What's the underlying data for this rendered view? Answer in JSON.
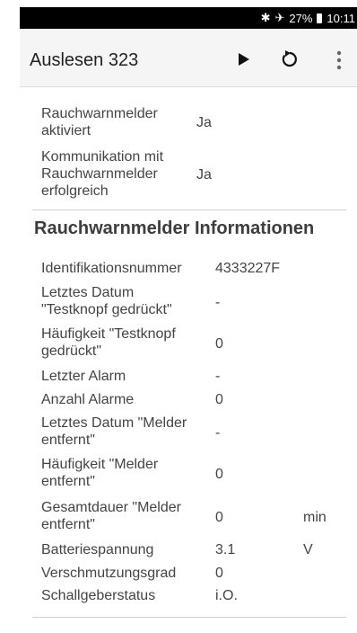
{
  "status_bar": {
    "icons": [
      "bluetooth-icon",
      "airplane-icon"
    ],
    "battery": "27%",
    "time": "10:11"
  },
  "app_bar": {
    "title": "Auslesen 323",
    "actions": [
      "play-icon",
      "refresh-icon",
      "more-vert-icon"
    ]
  },
  "top_rows": [
    {
      "label": "Rauchwarnmelder aktiviert",
      "value": "Ja"
    },
    {
      "label": "Kommunikation mit Rauchwarnmelder erfolgreich",
      "value": "Ja"
    }
  ],
  "section": {
    "heading": "Rauchwarnmelder Informationen",
    "rows": [
      {
        "label": "Identifikationsnummer",
        "value": "4333227F",
        "unit": ""
      },
      {
        "label": "Letztes Datum \"Testknopf gedrückt\"",
        "value": "-",
        "unit": ""
      },
      {
        "label": "Häufigkeit \"Testknopf gedrückt\"",
        "value": "0",
        "unit": ""
      },
      {
        "label": "Letzter Alarm",
        "value": "-",
        "unit": ""
      },
      {
        "label": "Anzahl Alarme",
        "value": "0",
        "unit": ""
      },
      {
        "label": "Letztes Datum \"Melder entfernt\"",
        "value": "-",
        "unit": ""
      },
      {
        "label": "Häufigkeit \"Melder entfernt\"",
        "value": "0",
        "unit": ""
      },
      {
        "label": "Gesamtdauer \"Melder entfernt\"",
        "value": "0",
        "unit": "min"
      },
      {
        "label": "Batteriespannung",
        "value": "3.1",
        "unit": "V"
      },
      {
        "label": "Verschmutzungsgrad",
        "value": "0",
        "unit": ""
      },
      {
        "label": "Schallgeberstatus",
        "value": "i.O.",
        "unit": ""
      }
    ]
  }
}
